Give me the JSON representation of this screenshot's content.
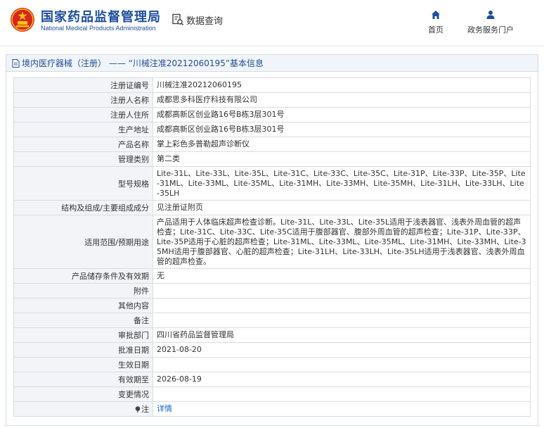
{
  "header": {
    "brand_cn": "国家药品监督管理局",
    "brand_en": "National Medical Products Administration",
    "query_label": "数据查询",
    "nav": {
      "home": "首页",
      "portal": "政务服务门户"
    }
  },
  "panel": {
    "title": "境内医疗器械（注册） —— “川械注准20212060195”基本信息"
  },
  "rows": [
    {
      "label": "注册证编号",
      "value": "川械注准20212060195"
    },
    {
      "label": "注册人名称",
      "value": "成都思多科医疗科技有限公司"
    },
    {
      "label": "注册人住所",
      "value": "成都高新区创业路16号B栋3层301号"
    },
    {
      "label": "生产地址",
      "value": "成都高新区创业路16号B栋3层301号"
    },
    {
      "label": "产品名称",
      "value": "掌上彩色多普勒超声诊断仪"
    },
    {
      "label": "管理类别",
      "value": "第二类"
    },
    {
      "label": "型号规格",
      "value": "Lite-31L、Lite-33L、Lite-35L、Lite-31C、Lite-33C、Lite-35C、Lite-31P、Lite-33P、Lite-35P、Lite-31ML、Lite-33ML、Lite-35ML、Lite-31MH、Lite-33MH、Lite-35MH、Lite-31LH、Lite-33LH、Lite-35LH"
    },
    {
      "label": "结构及组成/主要组成成分",
      "value": "见注册证附页"
    },
    {
      "label": "适用范围/预期用途",
      "value": "产品适用于人体临床超声检查诊断。Lite-31L、Lite-33L、Lite-35L适用于浅表器官、浅表外周血管的超声检查；Lite-31C、Lite-33C、Lite-35C适用于腹部器官、腹部外周血管的超声检查；Lite-31P、Lite-33P、Lite-35P适用于心脏的超声检查；Lite-31ML、Lite-33ML、Lite-35ML、Lite-31MH、Lite-33MH、Lite-35MH适用于腹部器官、心脏的超声检查；Lite-31LH、Lite-33LH、Lite-35LH适用于浅表器官、浅表外周血管的超声检查。"
    },
    {
      "label": "产品储存条件及有效期",
      "value": "无"
    },
    {
      "label": "附件",
      "value": ""
    },
    {
      "label": "其他内容",
      "value": ""
    },
    {
      "label": "备注",
      "value": ""
    },
    {
      "label": "审批部门",
      "value": "四川省药品监督管理局"
    },
    {
      "label": "批准日期",
      "value": "2021-08-20"
    },
    {
      "label": "生效日期",
      "value": ""
    },
    {
      "label": "有效期至",
      "value": "2026-08-19"
    },
    {
      "label": "变更情况",
      "value": ""
    },
    {
      "label": "注",
      "value": "详情"
    }
  ],
  "colors": {
    "brand_blue": "#1f4e9c",
    "link_blue": "#1a63c4",
    "label_bg": "#f2f4f7",
    "logo_red": "#d7261e",
    "logo_gold": "#f2c318"
  }
}
